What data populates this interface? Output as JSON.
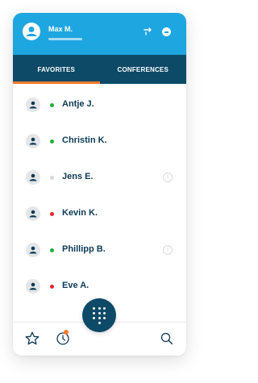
{
  "user": {
    "name": "Max M."
  },
  "header_icons": {
    "call_forward": "call-forward-icon",
    "dnd": "do-not-disturb-icon",
    "avatar": "user-avatar-icon"
  },
  "tabs": [
    {
      "label": "FAVORITES",
      "active": true
    },
    {
      "label": "CONFERENCES",
      "active": false
    }
  ],
  "contacts": [
    {
      "name": "Antje J.",
      "status": "online",
      "status_color": "#1fb03a",
      "info": false
    },
    {
      "name": "Christin K.",
      "status": "online",
      "status_color": "#1fb03a",
      "info": false
    },
    {
      "name": "Jens E.",
      "status": "offline",
      "status_color": "#d6d8da",
      "info": true
    },
    {
      "name": "Kevin K.",
      "status": "busy",
      "status_color": "#e02a2a",
      "info": false
    },
    {
      "name": "Phillipp B.",
      "status": "online",
      "status_color": "#1fb03a",
      "info": true
    },
    {
      "name": "Eve A.",
      "status": "busy",
      "status_color": "#e02a2a",
      "info": false
    }
  ],
  "info_glyph": "i",
  "bottom_nav": {
    "favorites": "star-icon",
    "recents": "clock-icon",
    "dialpad": "dialpad-icon",
    "search": "search-icon"
  },
  "colors": {
    "header": "#1ea6e0",
    "tabs": "#0d4a68",
    "accent": "#f47a2c"
  }
}
